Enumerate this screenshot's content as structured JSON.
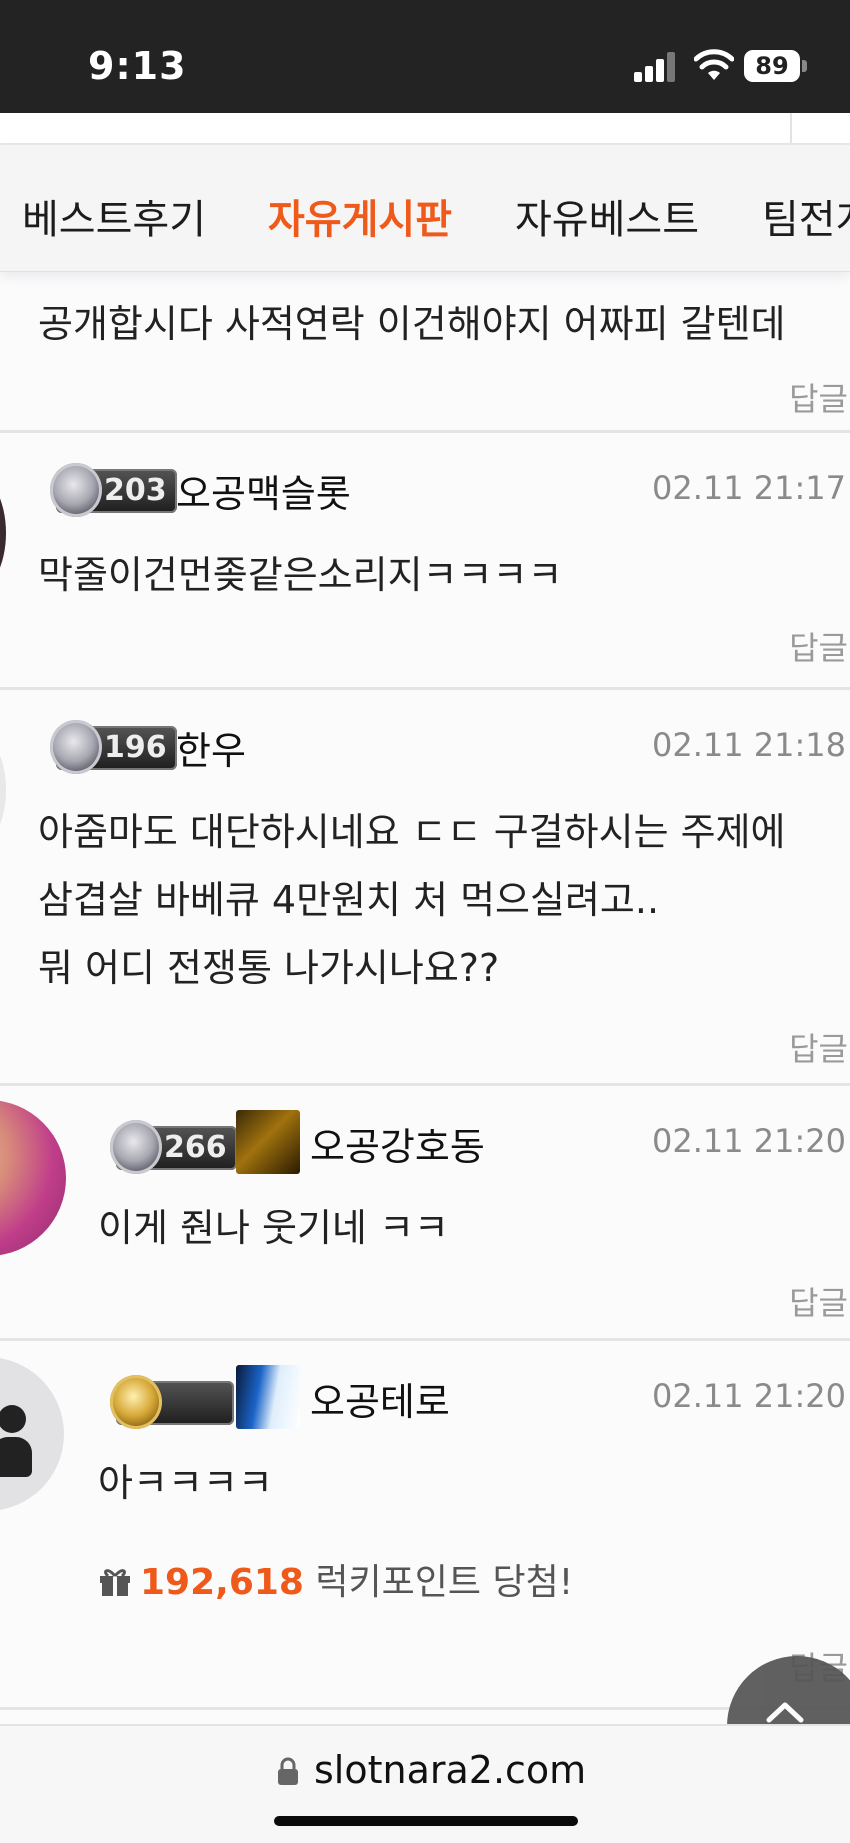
{
  "status_bar": {
    "time": "9:13",
    "battery": "89"
  },
  "tabs": [
    {
      "label": "베스트후기",
      "active": false
    },
    {
      "label": "자유게시판",
      "active": true
    },
    {
      "label": "자유베스트",
      "active": false
    },
    {
      "label": "팀전게",
      "active": false
    }
  ],
  "comments": [
    {
      "text_lines": [
        "공개합시다 사적연락 이건해야지 어짜피 갈텐데"
      ],
      "reply_label": "답글"
    },
    {
      "level": "203",
      "username": "오공맥슬롯",
      "date": "02.11 21:17",
      "text_lines": [
        "막줄이건먼좆같은소리지ㅋㅋㅋㅋ"
      ],
      "reply_label": "답글"
    },
    {
      "level": "196",
      "username": "한우",
      "date": "02.11 21:18",
      "text_lines": [
        "아줌마도 대단하시네요 ㄷㄷ 구걸하시는 주제에",
        "삼겹살 바베큐 4만원치 처 먹으실려고..",
        "뭐 어디 전쟁통 나가시나요??"
      ],
      "reply_label": "답글"
    },
    {
      "level": "266",
      "username": "오공강호동",
      "date": "02.11 21:20",
      "text_lines": [
        "이게 줜나 웃기네 ㅋㅋ"
      ],
      "reply_label": "답글"
    },
    {
      "level": "",
      "username": "오공테로",
      "date": "02.11 21:20",
      "text_lines": [
        "아ㅋㅋㅋㅋ"
      ],
      "lucky_points": "192,618",
      "lucky_label": "럭키포인트 당첨!",
      "reply_label": "답글"
    }
  ],
  "browser": {
    "url": "slotnara2.com"
  },
  "colors": {
    "accent": "#ef5a1b",
    "status_bar": "#232323"
  }
}
